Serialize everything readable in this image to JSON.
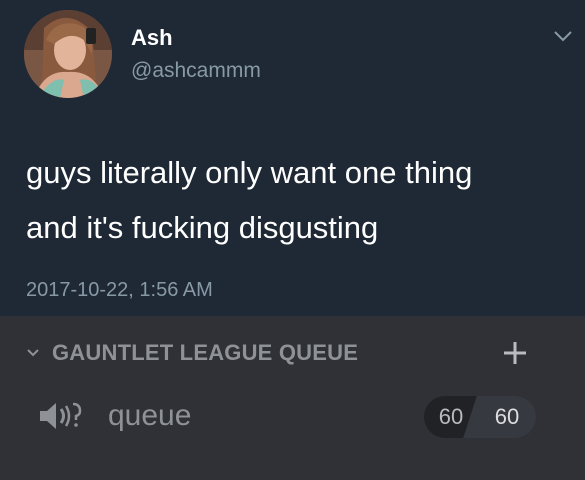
{
  "tweet": {
    "display_name": "Ash",
    "handle": "@ashcammm",
    "text_lines": [
      "guys literally only want one thing",
      "and it's fucking disgusting"
    ],
    "timestamp": "2017-10-22, 1:56 AM",
    "icons": {
      "avatar": "profile-photo",
      "menu": "chevron-down-icon"
    }
  },
  "discord": {
    "category": {
      "label": "GAUNTLET LEAGUE QUEUE",
      "icons": {
        "collapse": "chevron-down-icon",
        "add": "plus-icon"
      }
    },
    "channel": {
      "name": "queue",
      "icon": "speaker-icon",
      "user_count": "60",
      "user_limit": "60"
    }
  },
  "colors": {
    "tweet_background": "#1f2935",
    "discord_background": "#2f3136",
    "primary_text": "#ffffff",
    "secondary_text": "#8899a6",
    "discord_muted": "#8e9297"
  }
}
